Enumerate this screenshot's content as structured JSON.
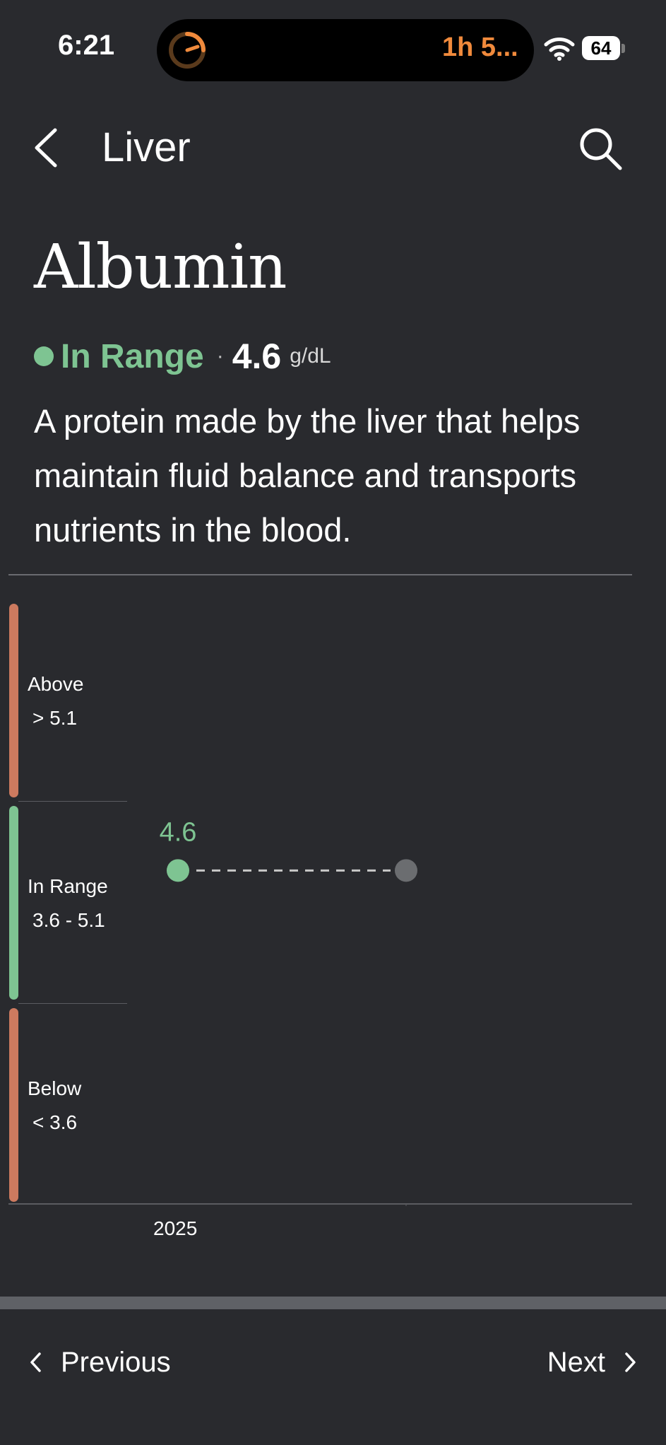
{
  "status_bar": {
    "time": "6:21",
    "island_text": "1h 5...",
    "battery_level": "64",
    "icons": [
      "timer-icon",
      "wifi-icon",
      "battery-icon"
    ]
  },
  "nav": {
    "back_icon": "chevron-left-icon",
    "title": "Liver",
    "search_icon": "search-icon"
  },
  "biomarker": {
    "name": "Albumin",
    "status": "In Range",
    "separator": "·",
    "value": "4.6",
    "unit": "g/dL",
    "description": "A protein made by the liver that helps maintain fluid balance and transports nutrients in the blood."
  },
  "ranges": [
    {
      "label": "Above",
      "range": "> 5.1",
      "color": "#cd7a5f"
    },
    {
      "label": "In Range",
      "range": "3.6 - 5.1",
      "color": "#7ec492"
    },
    {
      "label": "Below",
      "range": "< 3.6",
      "color": "#cd7a5f"
    }
  ],
  "chart_data": {
    "type": "scatter",
    "x": [
      "2025"
    ],
    "points": [
      {
        "x": "2025",
        "y": 4.6,
        "label": "4.6",
        "color": "#7ec492"
      }
    ],
    "projection_color": "#6b6d70",
    "bands": [
      {
        "name": "Below",
        "min": null,
        "max": 3.6
      },
      {
        "name": "In Range",
        "min": 3.6,
        "max": 5.1
      },
      {
        "name": "Above",
        "min": 5.1,
        "max": null
      }
    ]
  },
  "footer": {
    "previous_label": "Previous",
    "next_label": "Next"
  },
  "colors": {
    "background": "#292a2e",
    "in_range": "#7ec492",
    "out_of_range": "#cd7a5f",
    "island_accent": "#f08a3c"
  }
}
